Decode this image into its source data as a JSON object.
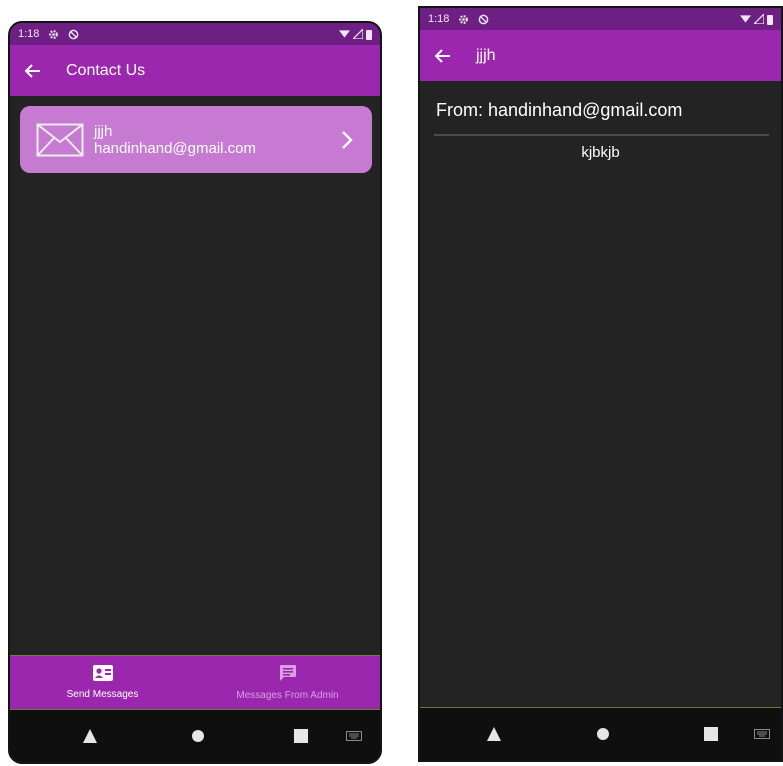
{
  "left_screen": {
    "status_bar": {
      "time": "1:18"
    },
    "app_bar": {
      "title": "Contact Us"
    },
    "messages": [
      {
        "name": "jjjh",
        "email": "handinhand@gmail.com"
      }
    ],
    "bottom_nav": [
      {
        "label": "Send Messages",
        "icon": "contact-card-icon",
        "active": true
      },
      {
        "label": "Messages From Admin",
        "icon": "chat-message-icon",
        "active": false
      }
    ]
  },
  "right_screen": {
    "status_bar": {
      "time": "1:18"
    },
    "app_bar": {
      "title": "jjjh"
    },
    "message": {
      "from": "From: handinhand@gmail.com",
      "body": "kjbkjb"
    }
  },
  "colors": {
    "status_bar": "#6e1f84",
    "app_bar": "#9b27af",
    "card": "#c77ad2",
    "background": "#232323",
    "system_nav": "#0f0f0f"
  }
}
